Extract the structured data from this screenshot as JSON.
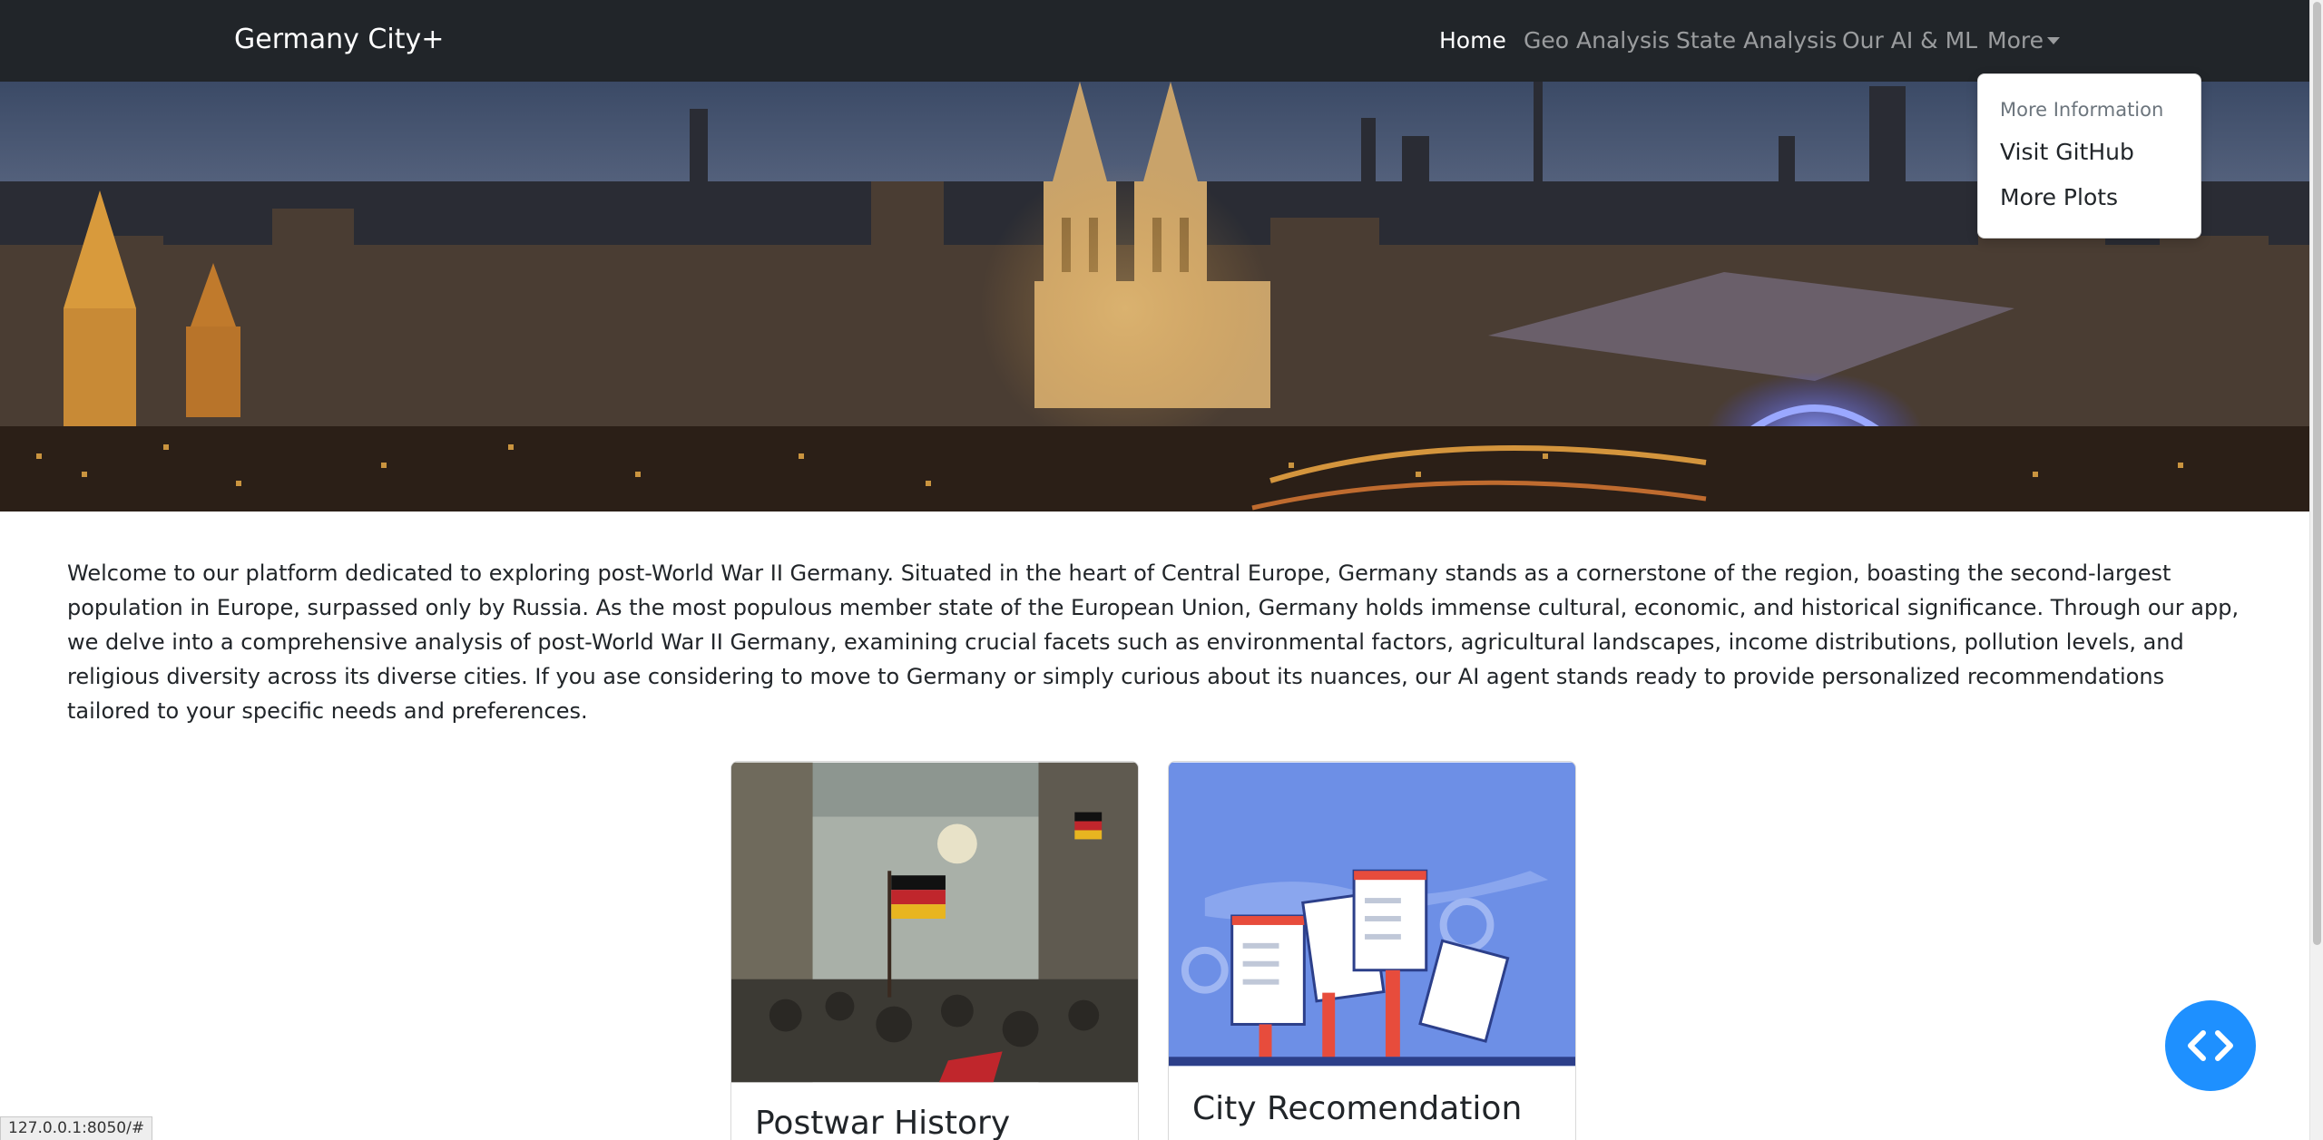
{
  "navbar": {
    "brand": "Germany City+",
    "links": [
      {
        "label": "Home",
        "active": true
      },
      {
        "label": "Geo Analysis",
        "active": false
      },
      {
        "label": "State Analysis",
        "active": false
      },
      {
        "label": "Our AI & ML",
        "active": false
      },
      {
        "label": "More",
        "active": false
      }
    ],
    "background_color": "#212529"
  },
  "dropdown": {
    "header": "More Information",
    "items": [
      "Visit GitHub",
      "More Plots"
    ]
  },
  "hero": {
    "image": "cologne-cathedral-night-skyline-photo"
  },
  "intro": {
    "text": "Welcome to our platform dedicated to exploring post-World War II Germany. Situated in the heart of Central Europe, Germany stands as a cornerstone of the region, boasting the second-largest population in Europe, surpassed only by Russia. As the most populous member state of the European Union, Germany holds immense cultural, economic, and historical significance. Through our app, we delve into a comprehensive analysis of post-World War II Germany, examining crucial facets such as environmental factors, agricultural landscapes, income distributions, pollution levels, and religious diversity across its diverse cities. If you ase considering to move to Germany or simply curious about its nuances, our AI agent stands ready to provide personalized recommendations tailored to your specific needs and preferences."
  },
  "cards": [
    {
      "title": "Postwar History",
      "image": "revolution-painting-with-flags"
    },
    {
      "title": "City Recomendation",
      "image": "survey-checklists-illustration"
    }
  ],
  "fab": {
    "icon": "code-brackets-icon",
    "color": "#1e90ff"
  },
  "status_bar": {
    "url": "127.0.0.1:8050/#"
  }
}
